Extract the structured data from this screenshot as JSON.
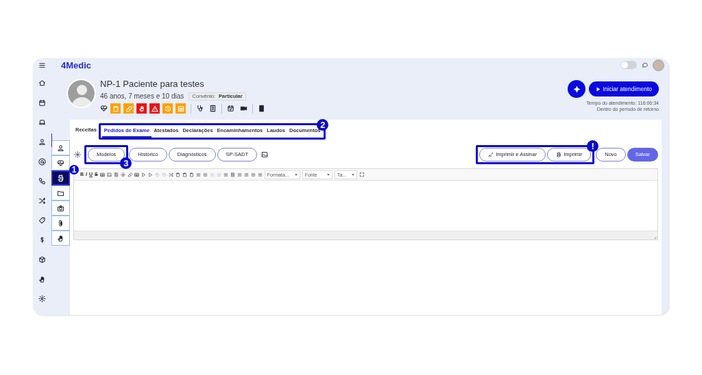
{
  "topbar": {
    "logo": "4Medic",
    "toggle_on": false
  },
  "secondary_sidebar": [
    {
      "selected": false
    },
    {
      "selected": false
    },
    {
      "selected": true,
      "annotation": "1"
    },
    {
      "selected": false
    },
    {
      "selected": false
    },
    {
      "selected": false
    },
    {
      "selected": false
    }
  ],
  "patient": {
    "name": "NP-1 Paciente para testes",
    "age": "46 anos, 7 meses e 10 dias",
    "insurance_label": "Convênio:",
    "insurance_value": "Particular"
  },
  "actions": {
    "start_button": "Iniciar atendimento",
    "elapsed": "Tempo do atendimento: 116:06:34",
    "return_status": "Dentro do período de retorno"
  },
  "tabs": [
    {
      "label": "Receitas",
      "selected": false
    },
    {
      "label": "Pedidos de Exame",
      "selected": true
    },
    {
      "label": "Atestados",
      "selected": false
    },
    {
      "label": "Declarações",
      "selected": false
    },
    {
      "label": "Encaminhamentos",
      "selected": false
    },
    {
      "label": "Laudos",
      "selected": false
    },
    {
      "label": "Documentos",
      "selected": false
    }
  ],
  "tabs_annotation": "2",
  "left_buttons": [
    {
      "label": "Modelos",
      "annotation": "3"
    },
    {
      "label": "Histórico"
    },
    {
      "label": "Diagnósticos"
    },
    {
      "label": "SP-SADT"
    }
  ],
  "print_buttons": [
    {
      "label": "Imprimir e Assinar"
    },
    {
      "label": "Imprimir"
    }
  ],
  "print_annotation": "!",
  "right_buttons": [
    {
      "label": "Novo",
      "kind": "outline"
    },
    {
      "label": "Salvar",
      "kind": "filled"
    }
  ],
  "editor": {
    "format_buttons": [
      "B",
      "I",
      "U",
      "S"
    ],
    "dropdowns": [
      "Formata...",
      "Fonte",
      "Ta..."
    ]
  }
}
